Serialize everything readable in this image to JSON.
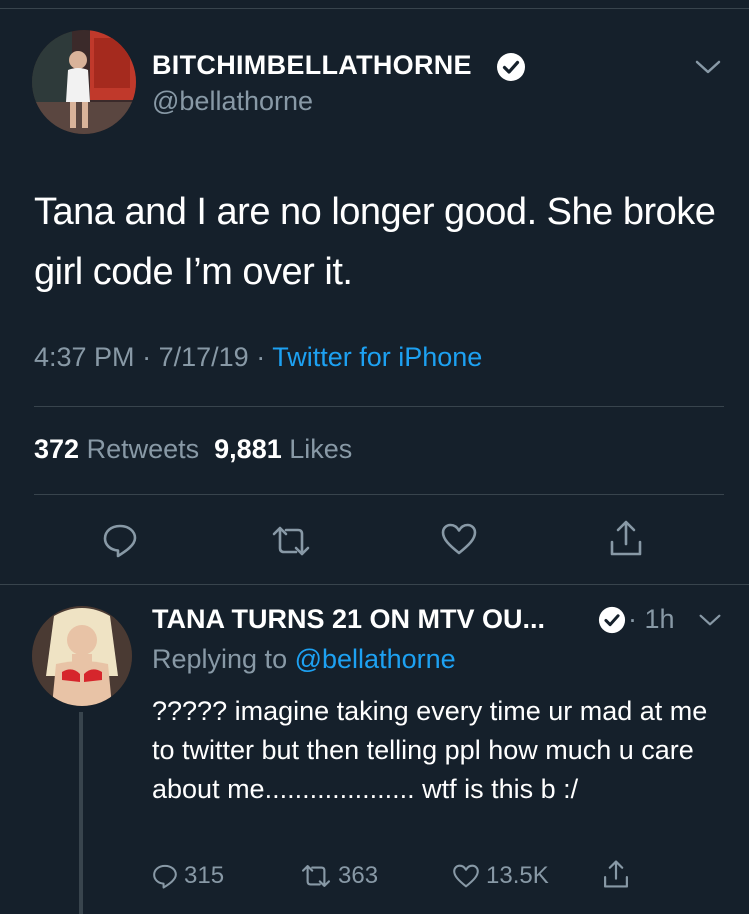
{
  "tweet": {
    "display_name": "BITCHIMBELLATHORNE",
    "handle": "@bellathorne",
    "text": "Tana and I are no longer good. She broke girl code I’m over it.",
    "time": "4:37 PM",
    "date": "7/17/19",
    "source": "Twitter for iPhone",
    "retweet_count": "372",
    "retweet_label": "Retweets",
    "like_count": "9,881",
    "like_label": "Likes",
    "icons": [
      "reply-icon",
      "retweet-icon",
      "like-icon",
      "share-icon"
    ]
  },
  "reply": {
    "display_name": "TANA TURNS 21 ON MTV OU...",
    "time": "1h",
    "replying_prefix": "Replying to",
    "replying_handle": "@bellathorne",
    "text": "????? imagine taking every time ur mad at me to twitter but then telling ppl how much u care about me.................... wtf is this b :/",
    "reply_count": "315",
    "retweet_count": "363",
    "like_count": "13.5K"
  },
  "colors": {
    "background": "#15202b",
    "secondary_text": "#8899a6",
    "link": "#1da1f2",
    "divider": "#38444d"
  }
}
